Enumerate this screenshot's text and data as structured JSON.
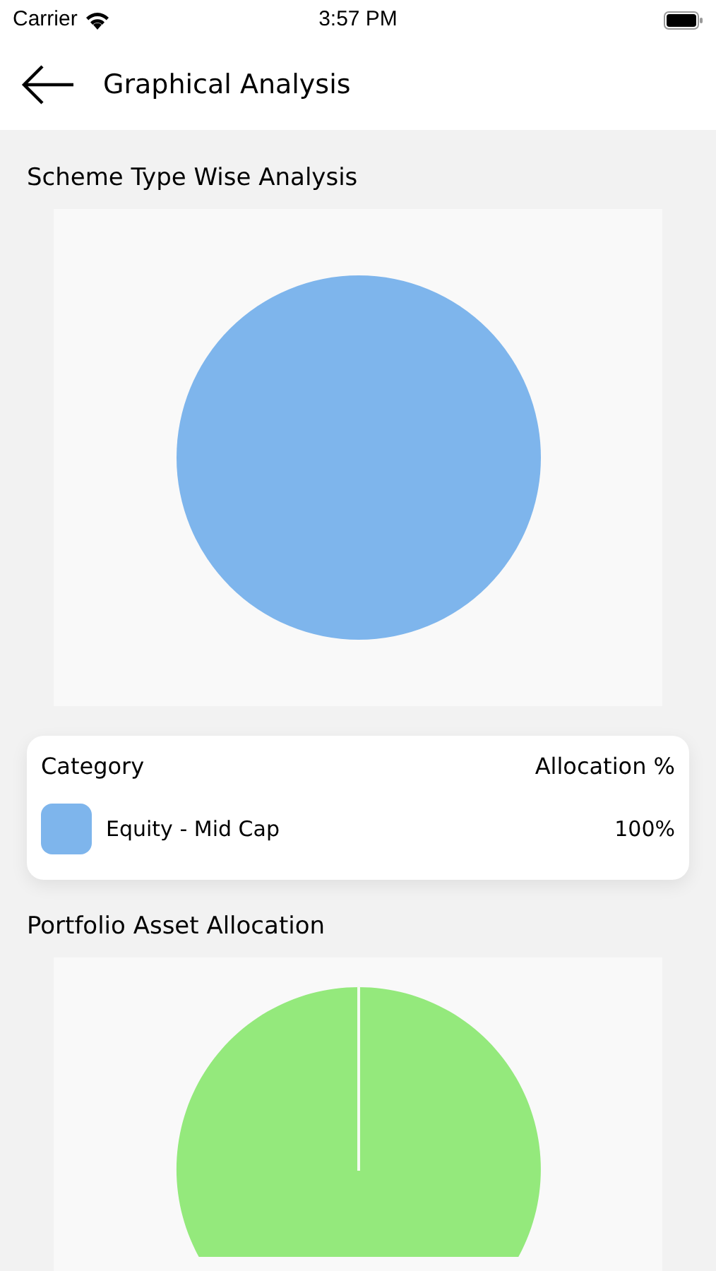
{
  "status_bar": {
    "carrier": "Carrier",
    "time": "3:57 PM"
  },
  "header": {
    "title": "Graphical Analysis"
  },
  "scheme_section": {
    "title": "Scheme Type Wise Analysis",
    "legend": {
      "column_1": "Category",
      "column_2": "Allocation %",
      "rows": [
        {
          "label": "Equity - Mid Cap",
          "value": "100%",
          "color": "#7eb5ec"
        }
      ]
    }
  },
  "asset_section": {
    "title": "Portfolio Asset Allocation"
  }
}
